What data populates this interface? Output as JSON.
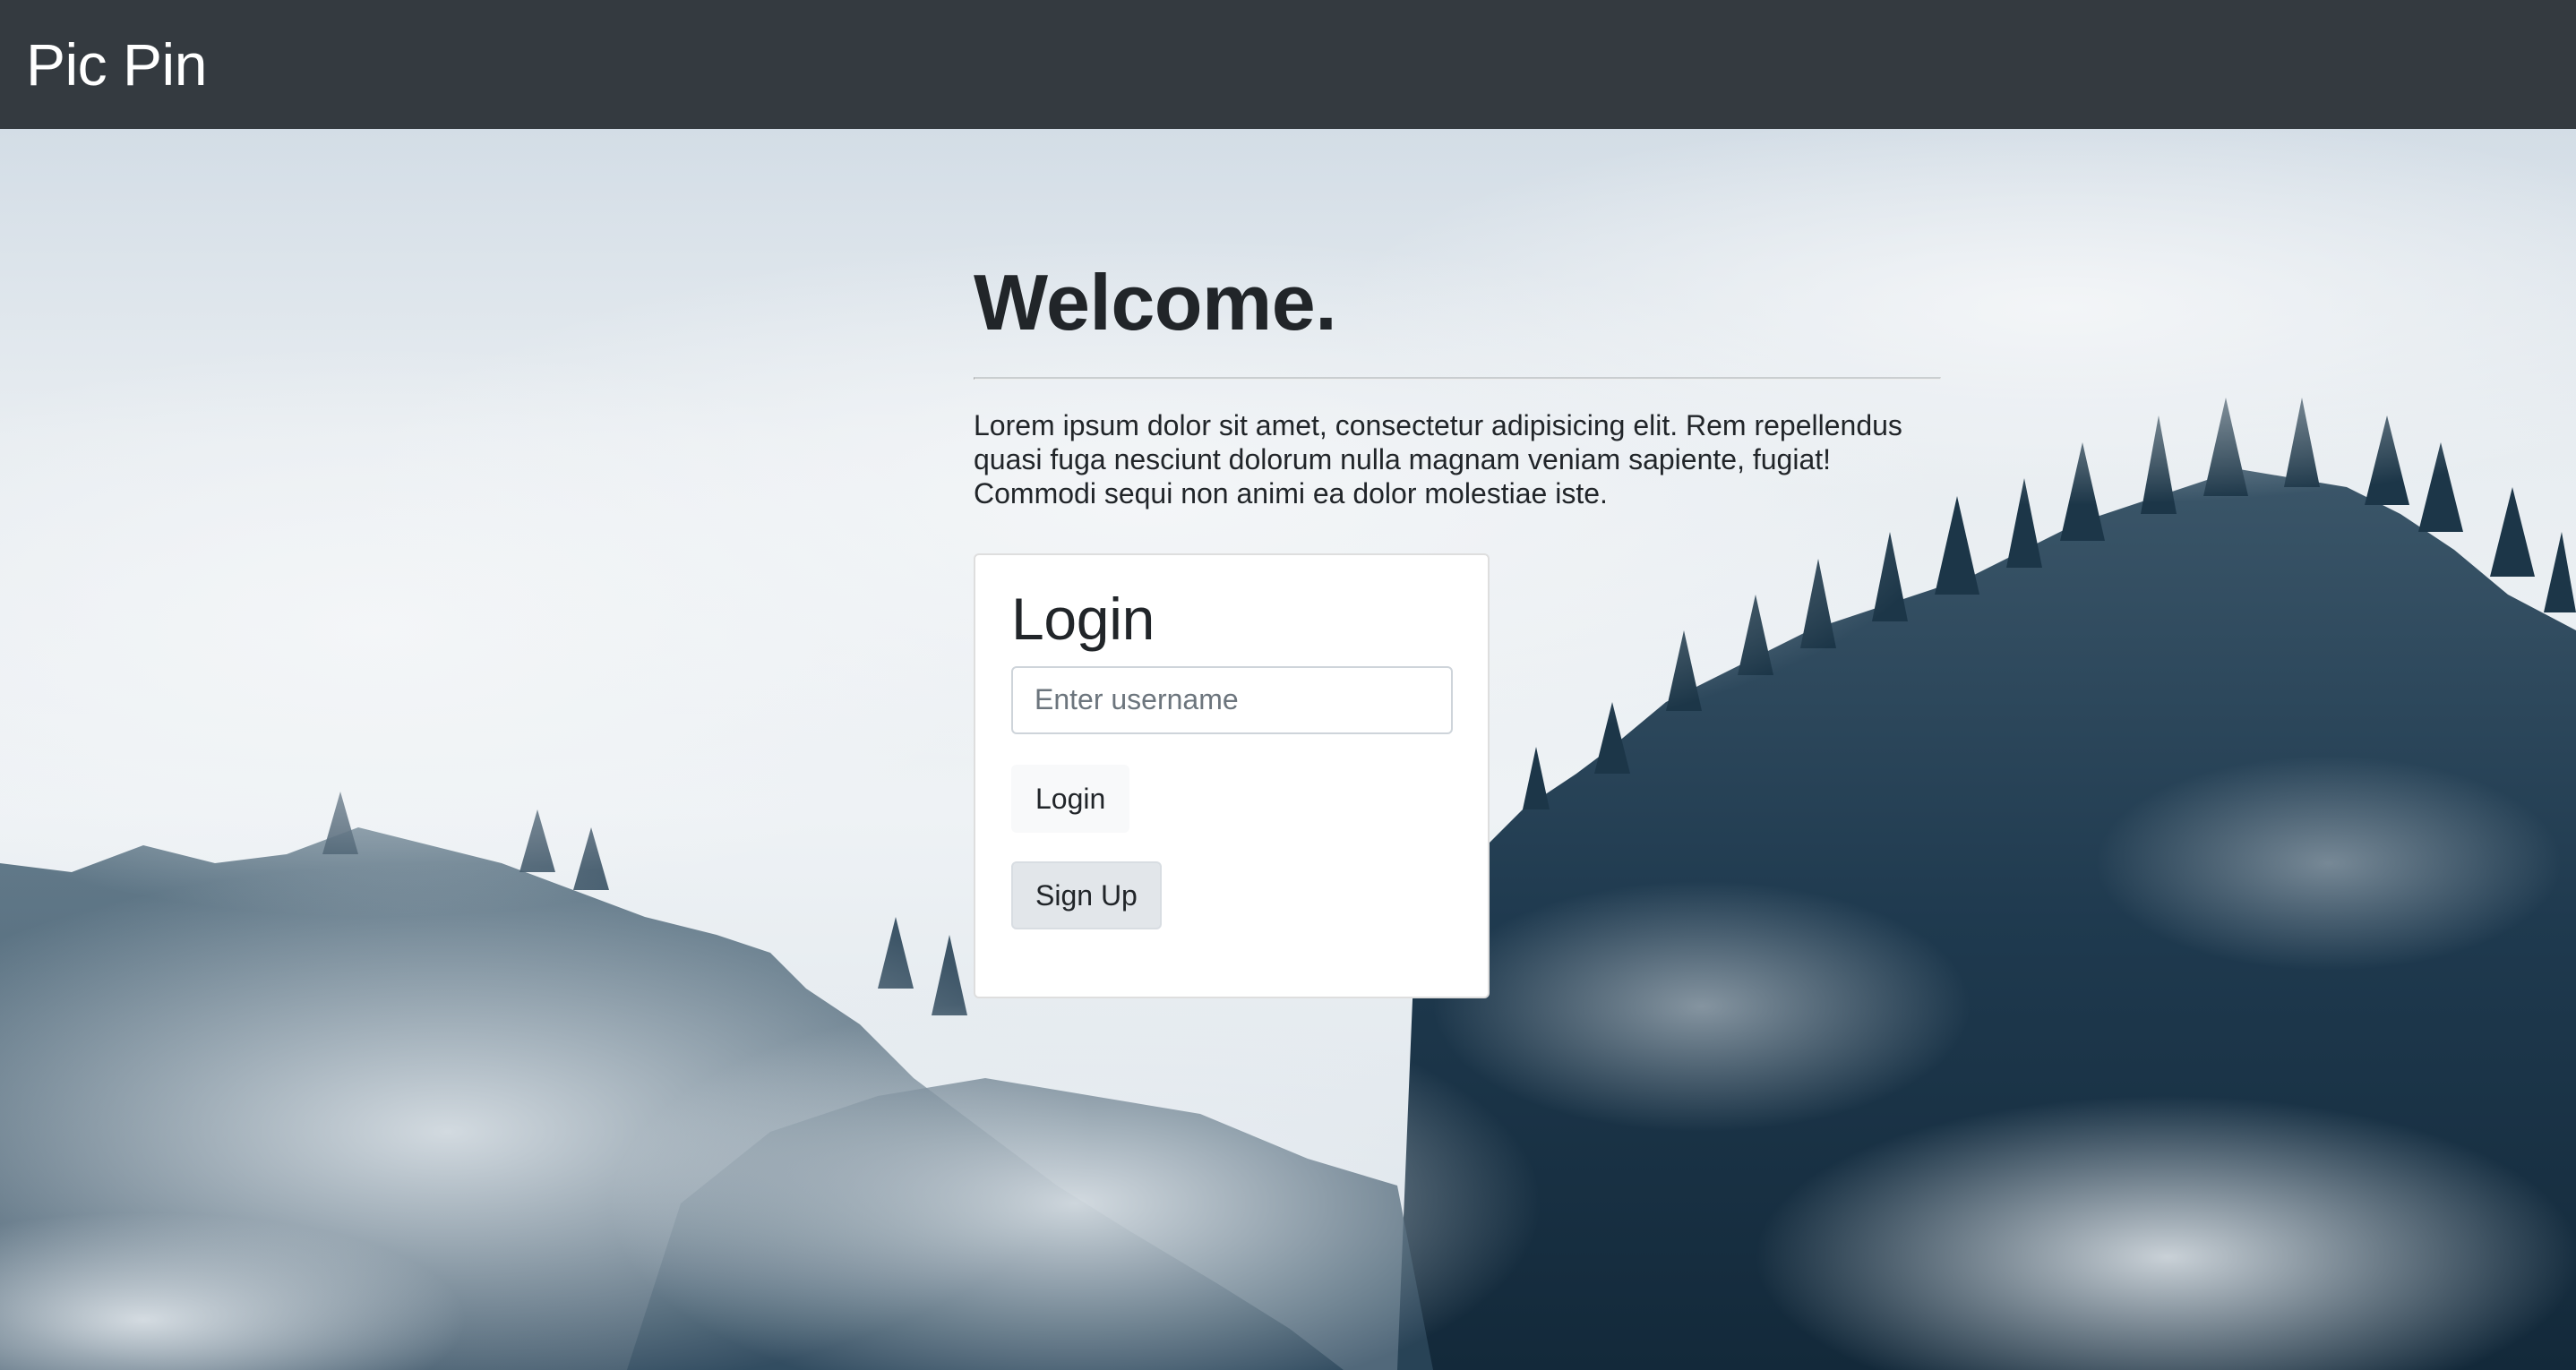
{
  "navbar": {
    "brand": "Pic Pin"
  },
  "hero": {
    "title": "Welcome.",
    "lead": "Lorem ipsum dolor sit amet, consectetur adipisicing elit. Rem repellendus quasi fuga nesciunt dolorum nulla magnam veniam sapiente, fugiat! Commodi sequi non animi ea dolor molestiae iste."
  },
  "login_card": {
    "title": "Login",
    "username_placeholder": "Enter username",
    "username_value": "",
    "login_label": "Login",
    "signup_label": "Sign Up"
  },
  "colors": {
    "navbar_bg": "#343a40",
    "text_dark": "#212529",
    "button_light": "#f8f9fa",
    "button_secondary": "#e2e6ea"
  }
}
